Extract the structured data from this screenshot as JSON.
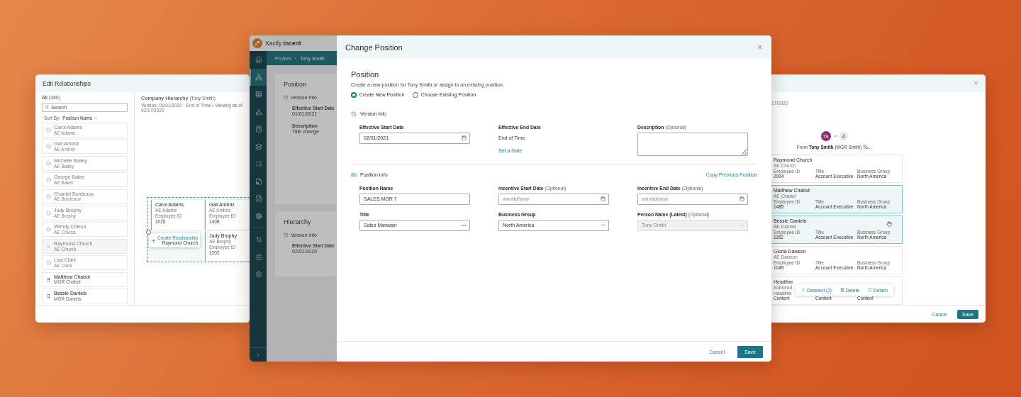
{
  "edit_relationships": {
    "title": "Edit Relationships",
    "all_label": "All",
    "all_count": "(386)",
    "search": {
      "placeholder": "Search"
    },
    "sort_label": "Sort By:",
    "sort_value": "Position Name",
    "list": [
      {
        "name": "Carol Adams",
        "sub": "AE Adams",
        "kind": "assigned"
      },
      {
        "name": "Gail Ambriz",
        "sub": "AE Ambriz",
        "kind": "assigned"
      },
      {
        "name": "Michelle Bailey",
        "sub": "AE Bailey",
        "kind": "assigned"
      },
      {
        "name": "George Baker",
        "sub": "AE Baker",
        "kind": "assigned"
      },
      {
        "name": "Chantel Bordeaux",
        "sub": "AE Bordeaux",
        "kind": "assigned"
      },
      {
        "name": "Judy Brophy",
        "sub": "AE Brophy",
        "kind": "assigned"
      },
      {
        "name": "Wendy Chiesa",
        "sub": "AE Chiesa",
        "kind": "assigned"
      },
      {
        "name": "Raymond Church",
        "sub": "AE Church",
        "kind": "dragging"
      },
      {
        "name": "Lisa Clark",
        "sub": "AE Clark",
        "kind": "assigned"
      },
      {
        "name": "Matthew Chabot",
        "sub": "MGR Chabot",
        "kind": "available"
      },
      {
        "name": "Bessie Daniels",
        "sub": "MGR Daniels",
        "kind": "available"
      }
    ],
    "hierarchy": {
      "title": "Company Hierarchy",
      "person": "(Tony Smith)",
      "meta": "Version: 01/01/2020 - End of Time  •  Viewing as of 02/17/2020",
      "nodes": [
        {
          "name": "Carol Adams",
          "sub": "AE Adams",
          "id_label": "Employee ID",
          "id": "1025"
        },
        {
          "name": "Gail Ambriz",
          "sub": "AE Ambriz",
          "id_label": "Employee ID",
          "id": "1408"
        },
        {
          "name": "Judy Brophy",
          "sub": "AE Brophy",
          "id_label": "Employee ID",
          "id": "1202"
        }
      ],
      "drag": {
        "action": "Create Relationship",
        "name": "Raymond Church"
      }
    }
  },
  "app": {
    "logo": {
      "brand": "Xactly",
      "product": "Incent"
    },
    "breadcrumb": [
      "Profiles",
      "Tony Smith"
    ],
    "sidebar": {
      "main": [
        {
          "selected": false
        },
        {
          "selected": true
        },
        {
          "selected": false
        },
        {
          "selected": false
        },
        {
          "selected": false
        },
        {
          "selected": false
        },
        {
          "selected": false
        },
        {
          "selected": false
        },
        {
          "selected": false
        },
        {
          "selected": false
        }
      ],
      "secondary": [
        {
          "selected": false
        },
        {
          "selected": false
        },
        {
          "selected": false
        }
      ]
    },
    "cards": [
      {
        "title": "Position",
        "section": "Version Info",
        "fields": [
          {
            "label": "Effective Start Date",
            "value": "01/01/2021"
          },
          {
            "label": "Description",
            "value": "Title change"
          }
        ]
      },
      {
        "title": "Hierarchy",
        "section": "Version Info",
        "fields": [
          {
            "label": "Effective Start Date",
            "value": "02/01/2020"
          }
        ]
      }
    ]
  },
  "change_position_dialog": {
    "title": "Change Position",
    "heading": "Position",
    "description": "Create a new position for Tony Smith or assign to an existing position.",
    "options": [
      {
        "label": "Create New Position",
        "selected": true
      },
      {
        "label": "Choose Existing Position",
        "selected": false
      }
    ],
    "version_info": {
      "title": "Version Info",
      "start": {
        "label": "Effective Start Date",
        "value": "02/01/2021"
      },
      "end": {
        "label": "Effective End Date",
        "value": "End of Time",
        "link": "Set a Date"
      },
      "description": {
        "label": "Description",
        "hint": "(Optional)"
      }
    },
    "position_info": {
      "title": "Position Info",
      "link": "Copy Previous Position",
      "fields": [
        {
          "label": "Position Name",
          "kind": "text",
          "value": "SALES MGR 7",
          "disabled": false
        },
        {
          "label": "Incentive Start Date",
          "hint": "(Optional)",
          "kind": "date",
          "placeholder": "mm/dd/yyyy",
          "disabled": false
        },
        {
          "label": "Incentive End Date",
          "hint": "(Optional)",
          "kind": "date",
          "placeholder": "mm/dd/yyyy",
          "disabled": false
        },
        {
          "label": "Title",
          "kind": "lookup",
          "value": "Sales Manager",
          "disabled": false
        },
        {
          "label": "Business Group",
          "kind": "select",
          "value": "North America",
          "disabled": false
        },
        {
          "label": "Person Name (Latest)",
          "hint": "(Optional)",
          "kind": "lookup",
          "value": "Tony Smith",
          "disabled": true
        }
      ]
    },
    "buttons": {
      "cancel": "Cancel",
      "save": "Save"
    }
  },
  "relationship_panel": {
    "meta": "17/2020",
    "from_avatar": "TS",
    "to_count": "4",
    "from_text": "From **Tony Smith** (MGR Smith) To...",
    "cards": [
      {
        "name": "Raymond Church",
        "sub": "AE Church",
        "selected": false,
        "columns": [
          {
            "label": "Employee ID",
            "value": "2004"
          },
          {
            "label": "Title",
            "value": "Account Executive"
          },
          {
            "label": "Business Group",
            "value": "North America"
          }
        ]
      },
      {
        "name": "Matthew Chabot",
        "sub": "AE Chabot",
        "selected": true,
        "columns": [
          {
            "label": "Employee ID",
            "value": "1485"
          },
          {
            "label": "Title",
            "value": "Account Executive"
          },
          {
            "label": "Business Group",
            "value": "North America"
          }
        ]
      },
      {
        "name": "Bessie Daniels",
        "sub": "AE Daniels",
        "selected": true,
        "columns": [
          {
            "label": "Employee ID",
            "value": "1152"
          },
          {
            "label": "Title",
            "value": "Account Executive"
          },
          {
            "label": "Business Group",
            "value": "North America"
          }
        ]
      },
      {
        "name": "Gloria Dawson",
        "sub": "AE Dawson",
        "selected": false,
        "columns": [
          {
            "label": "Employee ID",
            "value": "1049"
          },
          {
            "label": "Title",
            "value": "Account Executive"
          },
          {
            "label": "Business Group",
            "value": "North America"
          }
        ]
      },
      {
        "name": "Headline",
        "sub": "Subhead",
        "selected": false,
        "columns": [
          {
            "label": "Headline",
            "value": "Content"
          },
          {
            "value": "Content"
          },
          {
            "value": "Content"
          }
        ]
      }
    ],
    "actions": [
      {
        "label": "Deselect (2)",
        "kind": "deselect"
      },
      {
        "label": "Delete",
        "kind": "delete"
      },
      {
        "label": "Detach",
        "kind": "detach"
      }
    ],
    "buttons": {
      "cancel": "Cancel",
      "save": "Save"
    }
  }
}
